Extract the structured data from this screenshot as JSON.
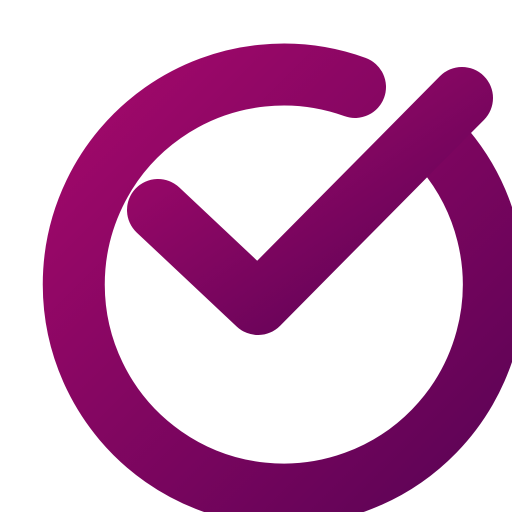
{
  "icon": {
    "name": "check-circle-icon",
    "gradient_start": "#A3086B",
    "gradient_end": "#5B0355"
  },
  "background": "#ffffff"
}
